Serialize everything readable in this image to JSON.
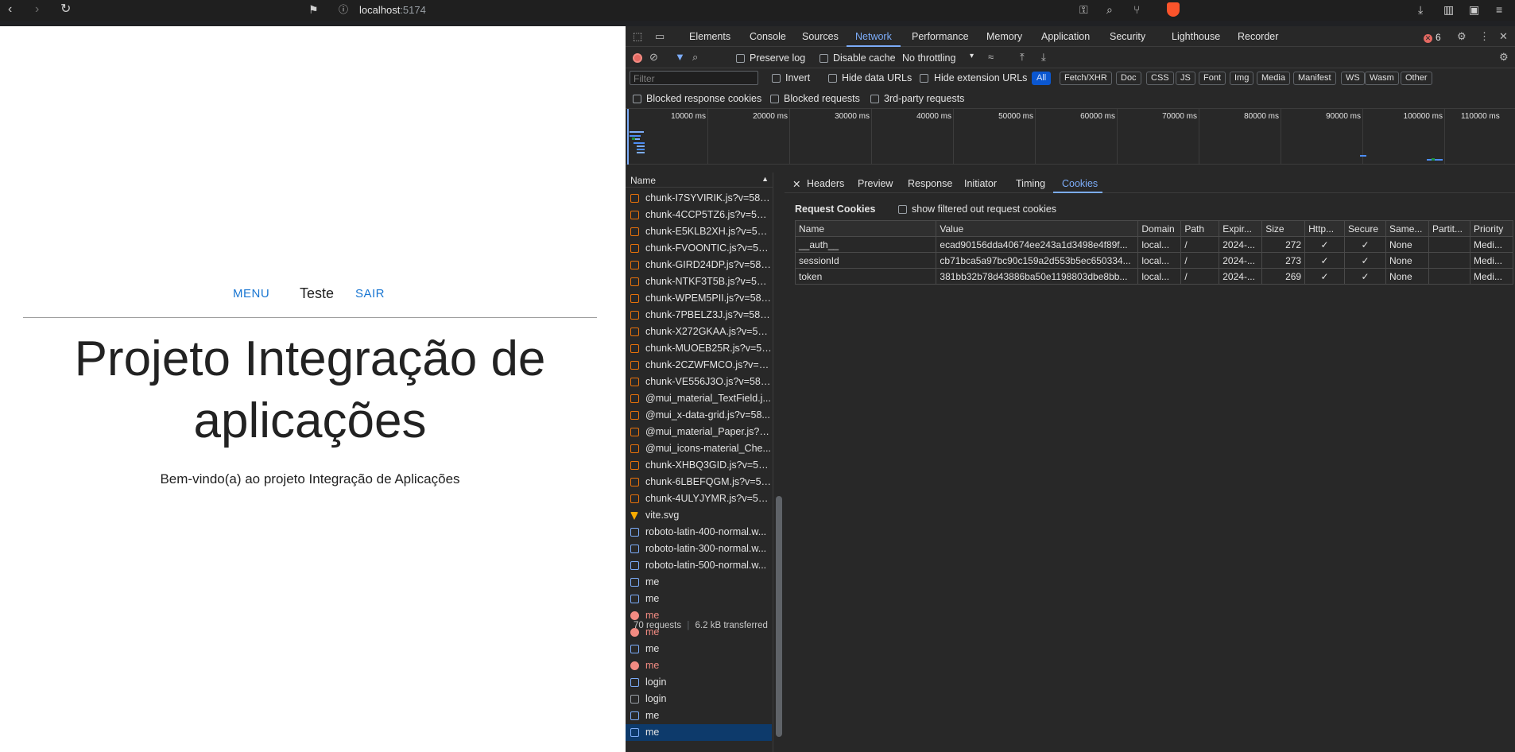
{
  "browser": {
    "url_host": "localhost",
    "url_port": ":5174"
  },
  "app": {
    "nav": {
      "menu": "MENU",
      "user": "Teste",
      "logout": "SAIR"
    },
    "title": "Projeto Integração de aplicações",
    "subtitle": "Bem-vindo(a) ao projeto Integração de Aplicações"
  },
  "devtools": {
    "tabs": [
      "Elements",
      "Console",
      "Sources",
      "Network",
      "Performance",
      "Memory",
      "Application",
      "Security",
      "Lighthouse",
      "Recorder"
    ],
    "active_tab": "Network",
    "error_count": "6",
    "toolbar": {
      "preserve_log": "Preserve log",
      "disable_cache": "Disable cache",
      "throttling": "No throttling"
    },
    "filter": {
      "placeholder": "Filter",
      "invert": "Invert",
      "hide_data_urls": "Hide data URLs",
      "hide_extension_urls": "Hide extension URLs",
      "types": [
        "All",
        "Fetch/XHR",
        "Doc",
        "CSS",
        "JS",
        "Font",
        "Img",
        "Media",
        "Manifest",
        "WS",
        "Wasm",
        "Other"
      ],
      "blocked_response_cookies": "Blocked response cookies",
      "blocked_requests": "Blocked requests",
      "third_party": "3rd-party requests"
    },
    "timeline_ticks": [
      "10000 ms",
      "20000 ms",
      "30000 ms",
      "40000 ms",
      "50000 ms",
      "60000 ms",
      "70000 ms",
      "80000 ms",
      "90000 ms",
      "100000 ms",
      "110000 ms"
    ],
    "requests": {
      "header": "Name",
      "items": [
        {
          "name": "chunk-I7SYVIRIK.js?v=582...",
          "kind": "js",
          "state": "normal"
        },
        {
          "name": "chunk-4CCP5TZ6.js?v=582...",
          "kind": "js",
          "state": "normal"
        },
        {
          "name": "chunk-E5KLB2XH.js?v=582...",
          "kind": "js",
          "state": "normal"
        },
        {
          "name": "chunk-FVOONTIC.js?v=582...",
          "kind": "js",
          "state": "normal"
        },
        {
          "name": "chunk-GIRD24DP.js?v=582...",
          "kind": "js",
          "state": "normal"
        },
        {
          "name": "chunk-NTKF3T5B.js?v=582...",
          "kind": "js",
          "state": "normal"
        },
        {
          "name": "chunk-WPEM5PII.js?v=582...",
          "kind": "js",
          "state": "normal"
        },
        {
          "name": "chunk-7PBELZ3J.js?v=582c...",
          "kind": "js",
          "state": "normal"
        },
        {
          "name": "chunk-X272GKAA.js?v=582...",
          "kind": "js",
          "state": "normal"
        },
        {
          "name": "chunk-MUOEB25R.js?v=58...",
          "kind": "js",
          "state": "normal"
        },
        {
          "name": "chunk-2CZWFMCO.js?v=58...",
          "kind": "js",
          "state": "normal"
        },
        {
          "name": "chunk-VE556J3O.js?v=582...",
          "kind": "js",
          "state": "normal"
        },
        {
          "name": "@mui_material_TextField.j...",
          "kind": "js",
          "state": "normal"
        },
        {
          "name": "@mui_x-data-grid.js?v=58...",
          "kind": "js",
          "state": "normal"
        },
        {
          "name": "@mui_material_Paper.js?v...",
          "kind": "js",
          "state": "normal"
        },
        {
          "name": "@mui_icons-material_Che...",
          "kind": "js",
          "state": "normal"
        },
        {
          "name": "chunk-XHBQ3GID.js?v=582...",
          "kind": "js",
          "state": "normal"
        },
        {
          "name": "chunk-6LBEFQGM.js?v=58...",
          "kind": "js",
          "state": "normal"
        },
        {
          "name": "chunk-4ULYJYMR.js?v=582...",
          "kind": "js",
          "state": "normal"
        },
        {
          "name": "vite.svg",
          "kind": "svg",
          "state": "normal"
        },
        {
          "name": "roboto-latin-400-normal.w...",
          "kind": "font",
          "state": "normal"
        },
        {
          "name": "roboto-latin-300-normal.w...",
          "kind": "font",
          "state": "normal"
        },
        {
          "name": "roboto-latin-500-normal.w...",
          "kind": "font",
          "state": "normal"
        },
        {
          "name": "me",
          "kind": "fetch",
          "state": "normal"
        },
        {
          "name": "me",
          "kind": "fetch",
          "state": "normal"
        },
        {
          "name": "me",
          "kind": "fetch",
          "state": "error"
        },
        {
          "name": "me",
          "kind": "fetch",
          "state": "error"
        },
        {
          "name": "me",
          "kind": "fetch",
          "state": "normal"
        },
        {
          "name": "me",
          "kind": "fetch",
          "state": "error"
        },
        {
          "name": "login",
          "kind": "fetch",
          "state": "normal"
        },
        {
          "name": "login",
          "kind": "doc",
          "state": "normal"
        },
        {
          "name": "me",
          "kind": "fetch",
          "state": "normal"
        },
        {
          "name": "me",
          "kind": "fetch",
          "state": "selected"
        }
      ]
    },
    "status": {
      "requests": "70 requests",
      "transferred": "6.2 kB transferred"
    },
    "detail": {
      "tabs": [
        "Headers",
        "Preview",
        "Response",
        "Initiator",
        "Timing",
        "Cookies"
      ],
      "active_tab": "Cookies",
      "section_title": "Request Cookies",
      "show_filtered": "show filtered out request cookies",
      "columns": [
        "Name",
        "Value",
        "Domain",
        "Path",
        "Expir...",
        "Size",
        "Http...",
        "Secure",
        "Same...",
        "Partit...",
        "Priority"
      ],
      "rows": [
        [
          "__auth__",
          "ecad90156dda40674ee243a1d3498e4f89f...",
          "local...",
          "/",
          "2024-...",
          "272",
          "✓",
          "✓",
          "None",
          "",
          "Medi..."
        ],
        [
          "sessionId",
          "cb71bca5a97bc90c159a2d553b5ec650334...",
          "local...",
          "/",
          "2024-...",
          "273",
          "✓",
          "✓",
          "None",
          "",
          "Medi..."
        ],
        [
          "token",
          "381bb32b78d43886ba50e1198803dbe8bb...",
          "local...",
          "/",
          "2024-...",
          "269",
          "✓",
          "✓",
          "None",
          "",
          "Medi..."
        ]
      ]
    }
  }
}
